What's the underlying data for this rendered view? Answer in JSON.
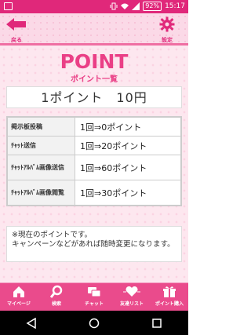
{
  "status_bar": {
    "battery": "92%",
    "time": "15:17"
  },
  "header": {
    "back_label": "戻る",
    "settings_label": "設定"
  },
  "page": {
    "title": "POINT",
    "subtitle": "ポイント一覧",
    "rate": "1ポイント　10円"
  },
  "table": {
    "rows": [
      {
        "label": "掲示板投稿",
        "value": "1回⇒0ポイント"
      },
      {
        "label": "ﾁｬｯﾄ送信",
        "value": "1回⇒20ポイント"
      },
      {
        "label": "ﾁｬｯﾄｱﾙﾊﾞﾑ画像送信",
        "value": "1回⇒60ポイント"
      },
      {
        "label": "ﾁｬｯﾄｱﾙﾊﾞﾑ画像閲覧",
        "value": "1回⇒30ポイント"
      }
    ]
  },
  "note": {
    "line1": "※現在のポイントです。",
    "line2": "キャンペーンなどがあれば随時変更になります。"
  },
  "bottom_nav": {
    "items": [
      {
        "label": "マイページ",
        "icon": "home-icon"
      },
      {
        "label": "検索",
        "icon": "search-icon"
      },
      {
        "label": "チャット",
        "icon": "chat-icon"
      },
      {
        "label": "友達リスト",
        "icon": "heart-icon"
      },
      {
        "label": "ポイント購入",
        "icon": "gift-icon"
      }
    ]
  },
  "colors": {
    "accent": "#e0287a",
    "title": "#ea3f86",
    "nav_bg": "#ea4b8c"
  }
}
